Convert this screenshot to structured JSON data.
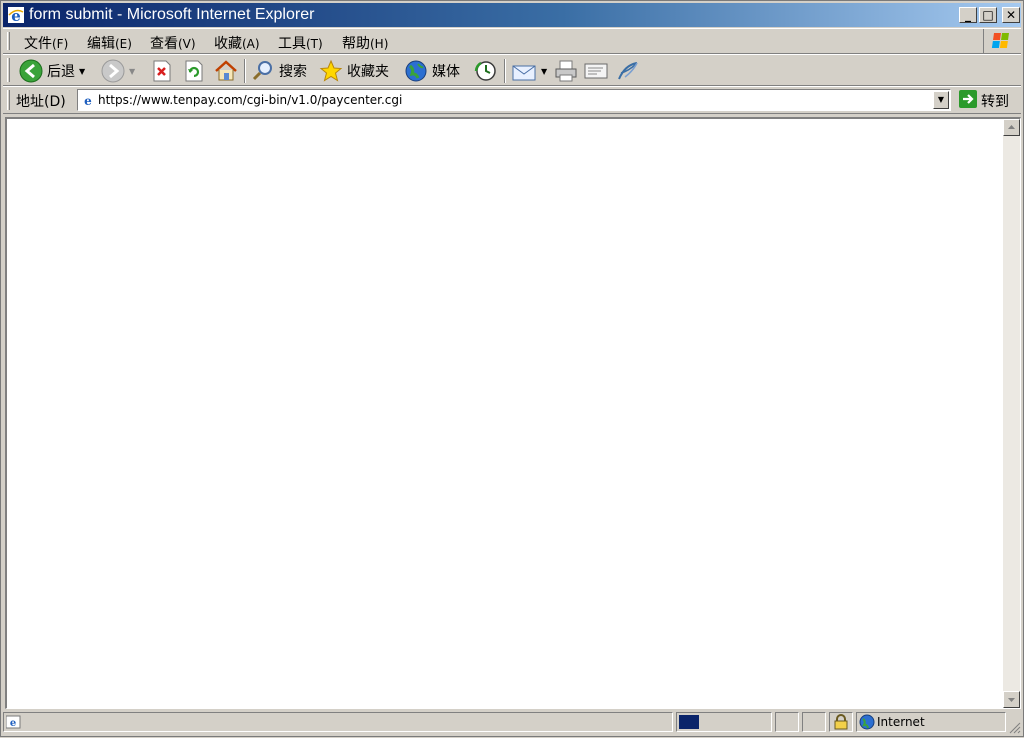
{
  "window": {
    "title": "form submit - Microsoft Internet Explorer"
  },
  "menu": [
    {
      "label": "文件",
      "accel": "(F)"
    },
    {
      "label": "编辑",
      "accel": "(E)"
    },
    {
      "label": "查看",
      "accel": "(V)"
    },
    {
      "label": "收藏",
      "accel": "(A)"
    },
    {
      "label": "工具",
      "accel": "(T)"
    },
    {
      "label": "帮助",
      "accel": "(H)"
    }
  ],
  "toolbar": {
    "back_label": "后退",
    "search_label": "搜索",
    "favorites_label": "收藏夹",
    "media_label": "媒体"
  },
  "address": {
    "label": "地址(D)",
    "url": "https://www.tenpay.com/cgi-bin/v1.0/paycenter.cgi",
    "go_label": "转到"
  },
  "status": {
    "zone": "Internet",
    "progress_fraction": 0.22
  },
  "colors": {
    "title_start": "#0a246a",
    "title_end": "#a6caf0",
    "chrome": "#d4d0c8"
  }
}
